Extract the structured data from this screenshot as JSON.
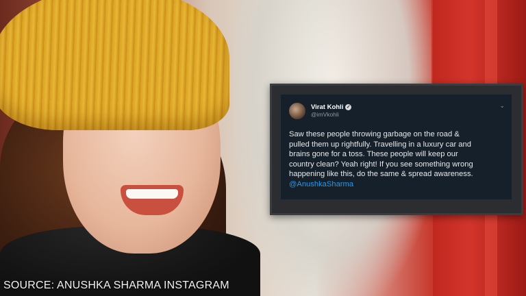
{
  "tweet": {
    "author_name": "Virat Kohli",
    "author_handle": "@imVkohli",
    "verified_icon": "check-icon",
    "body": "Saw these people throwing garbage on the road &\npulled them up rightfully. Travelling in a luxury car and\nbrains gone for a toss. These people will keep our\ncountry clean? Yeah right! If you see something wrong\nhappening like this, do the same & spread awareness.",
    "mention": "@AnushkaSharma"
  },
  "caption": {
    "source": "SOURCE: ANUSHKA SHARMA INSTAGRAM"
  },
  "colors": {
    "tweet_background": "#15202b",
    "mention_link": "#1d9bf0",
    "beanie": "#e0a92b"
  }
}
